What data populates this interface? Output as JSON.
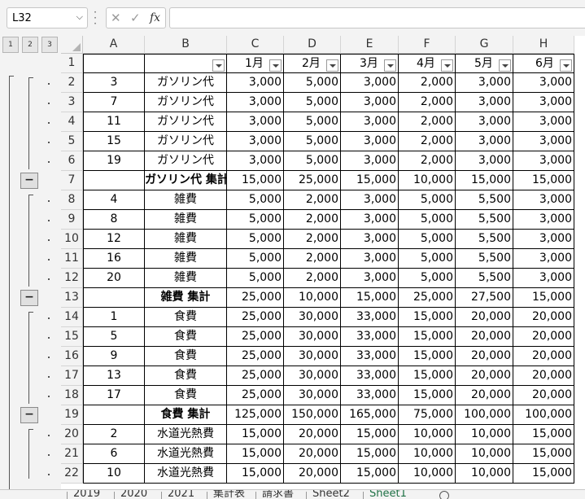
{
  "formula_bar": {
    "name_box": "L32",
    "cancel_icon": "✕",
    "enter_icon": "✓",
    "fx_label": "fx",
    "formula": ""
  },
  "outline_levels": [
    "1",
    "2",
    "3"
  ],
  "columns": [
    "A",
    "B",
    "C",
    "D",
    "E",
    "F",
    "G",
    "H"
  ],
  "header_row": {
    "row": "1",
    "cells": [
      "",
      "",
      "1月",
      "2月",
      "3月",
      "4月",
      "5月",
      "6月"
    ]
  },
  "rows": [
    {
      "row": "2",
      "a": "3",
      "b": "ガソリン代",
      "v": [
        "3,000",
        "5,000",
        "3,000",
        "2,000",
        "3,000",
        "3,000"
      ],
      "subtotal": false
    },
    {
      "row": "3",
      "a": "7",
      "b": "ガソリン代",
      "v": [
        "3,000",
        "5,000",
        "3,000",
        "2,000",
        "3,000",
        "3,000"
      ],
      "subtotal": false
    },
    {
      "row": "4",
      "a": "11",
      "b": "ガソリン代",
      "v": [
        "3,000",
        "5,000",
        "3,000",
        "2,000",
        "3,000",
        "3,000"
      ],
      "subtotal": false
    },
    {
      "row": "5",
      "a": "15",
      "b": "ガソリン代",
      "v": [
        "3,000",
        "5,000",
        "3,000",
        "2,000",
        "3,000",
        "3,000"
      ],
      "subtotal": false
    },
    {
      "row": "6",
      "a": "19",
      "b": "ガソリン代",
      "v": [
        "3,000",
        "5,000",
        "3,000",
        "2,000",
        "3,000",
        "3,000"
      ],
      "subtotal": false
    },
    {
      "row": "7",
      "a": "",
      "b": "ガソリン代 集計",
      "v": [
        "15,000",
        "25,000",
        "15,000",
        "10,000",
        "15,000",
        "15,000"
      ],
      "subtotal": true
    },
    {
      "row": "8",
      "a": "4",
      "b": "雑費",
      "v": [
        "5,000",
        "2,000",
        "3,000",
        "5,000",
        "5,500",
        "3,000"
      ],
      "subtotal": false
    },
    {
      "row": "9",
      "a": "8",
      "b": "雑費",
      "v": [
        "5,000",
        "2,000",
        "3,000",
        "5,000",
        "5,500",
        "3,000"
      ],
      "subtotal": false
    },
    {
      "row": "10",
      "a": "12",
      "b": "雑費",
      "v": [
        "5,000",
        "2,000",
        "3,000",
        "5,000",
        "5,500",
        "3,000"
      ],
      "subtotal": false
    },
    {
      "row": "11",
      "a": "16",
      "b": "雑費",
      "v": [
        "5,000",
        "2,000",
        "3,000",
        "5,000",
        "5,500",
        "3,000"
      ],
      "subtotal": false
    },
    {
      "row": "12",
      "a": "20",
      "b": "雑費",
      "v": [
        "5,000",
        "2,000",
        "3,000",
        "5,000",
        "5,500",
        "3,000"
      ],
      "subtotal": false
    },
    {
      "row": "13",
      "a": "",
      "b": "雑費 集計",
      "v": [
        "25,000",
        "10,000",
        "15,000",
        "25,000",
        "27,500",
        "15,000"
      ],
      "subtotal": true
    },
    {
      "row": "14",
      "a": "1",
      "b": "食費",
      "v": [
        "25,000",
        "30,000",
        "33,000",
        "15,000",
        "20,000",
        "20,000"
      ],
      "subtotal": false
    },
    {
      "row": "15",
      "a": "5",
      "b": "食費",
      "v": [
        "25,000",
        "30,000",
        "33,000",
        "15,000",
        "20,000",
        "20,000"
      ],
      "subtotal": false
    },
    {
      "row": "16",
      "a": "9",
      "b": "食費",
      "v": [
        "25,000",
        "30,000",
        "33,000",
        "15,000",
        "20,000",
        "20,000"
      ],
      "subtotal": false
    },
    {
      "row": "17",
      "a": "13",
      "b": "食費",
      "v": [
        "25,000",
        "30,000",
        "33,000",
        "15,000",
        "20,000",
        "20,000"
      ],
      "subtotal": false
    },
    {
      "row": "18",
      "a": "17",
      "b": "食費",
      "v": [
        "25,000",
        "30,000",
        "33,000",
        "15,000",
        "20,000",
        "20,000"
      ],
      "subtotal": false
    },
    {
      "row": "19",
      "a": "",
      "b": "食費 集計",
      "v": [
        "125,000",
        "150,000",
        "165,000",
        "75,000",
        "100,000",
        "100,000"
      ],
      "subtotal": true
    },
    {
      "row": "20",
      "a": "2",
      "b": "水道光熱費",
      "v": [
        "15,000",
        "20,000",
        "15,000",
        "10,000",
        "10,000",
        "15,000"
      ],
      "subtotal": false
    },
    {
      "row": "21",
      "a": "6",
      "b": "水道光熱費",
      "v": [
        "15,000",
        "20,000",
        "15,000",
        "10,000",
        "10,000",
        "15,000"
      ],
      "subtotal": false
    },
    {
      "row": "22",
      "a": "10",
      "b": "水道光熱費",
      "v": [
        "15,000",
        "20,000",
        "15,000",
        "10,000",
        "10,000",
        "15,000"
      ],
      "subtotal": false
    }
  ],
  "outline_collapse_symbol": "−",
  "sheet_tabs": [
    "2019",
    "2020",
    "2021",
    "集計表",
    "請求書",
    "Sheet2",
    "Sheet1"
  ],
  "active_sheet": "Sheet1",
  "colors": {
    "active_tab": "#1e7145",
    "grid_border": "#000000",
    "chrome": "#f3f3f3"
  }
}
